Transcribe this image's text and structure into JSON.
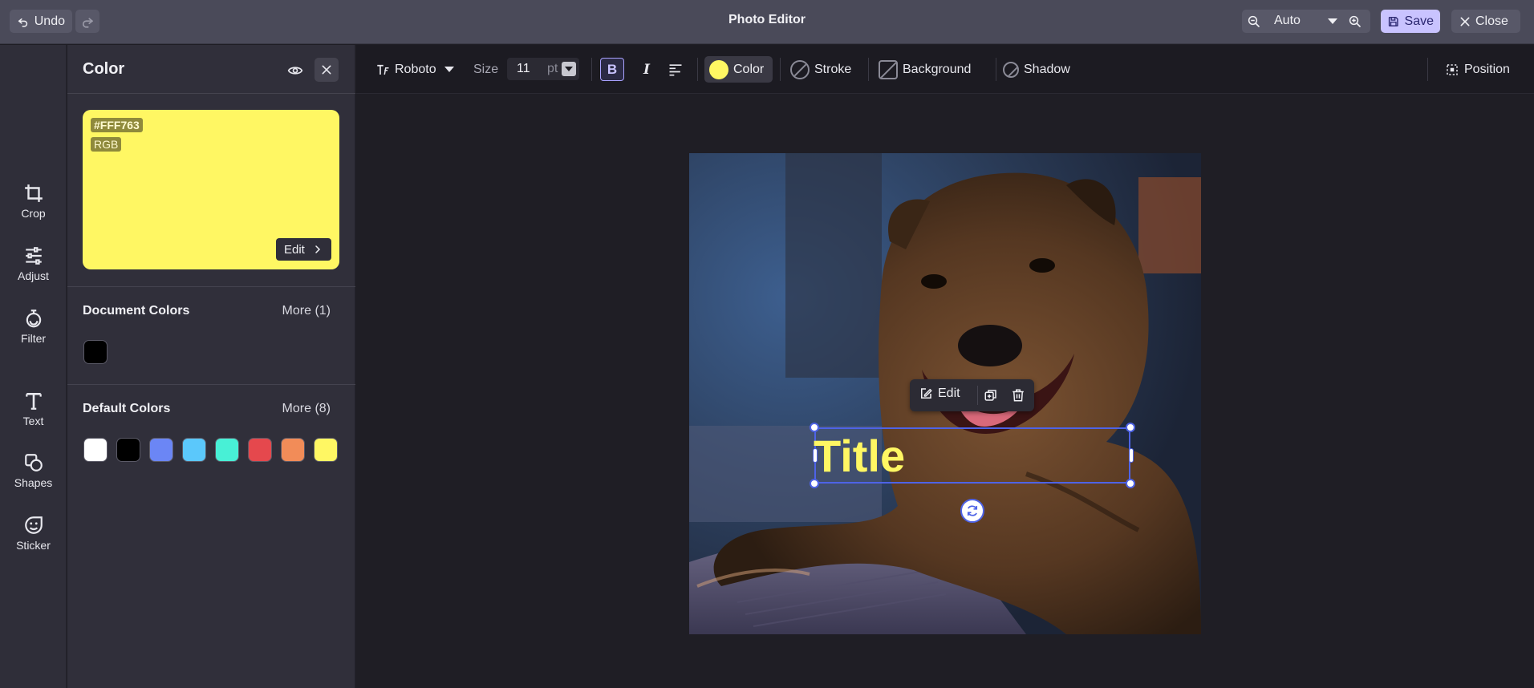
{
  "app": {
    "title": "Photo Editor"
  },
  "topbar": {
    "undo_label": "Undo",
    "zoom_value": "Auto",
    "save_label": "Save",
    "close_label": "Close"
  },
  "rail": {
    "items": [
      {
        "label": "Crop",
        "icon": "crop-icon"
      },
      {
        "label": "Adjust",
        "icon": "sliders-icon"
      },
      {
        "label": "Filter",
        "icon": "filter-icon"
      },
      {
        "label": "Text",
        "icon": "text-icon"
      },
      {
        "label": "Shapes",
        "icon": "shapes-icon"
      },
      {
        "label": "Sticker",
        "icon": "sticker-icon"
      }
    ]
  },
  "panel": {
    "title": "Color",
    "current_color": {
      "hex": "#FFF763",
      "mode": "RGB",
      "edit_label": "Edit"
    },
    "document_colors": {
      "title": "Document Colors",
      "more_label": "More (1)",
      "colors": [
        "#000000"
      ]
    },
    "default_colors": {
      "title": "Default Colors",
      "more_label": "More (8)",
      "colors": [
        "#ffffff",
        "#000000",
        "#6b86f5",
        "#5bc8fb",
        "#48f0d6",
        "#e5484d",
        "#f28c58",
        "#fff763"
      ]
    }
  },
  "toolbar": {
    "font_family": "Roboto",
    "size_label": "Size",
    "size_value": "11",
    "size_unit": "pt",
    "bold_label": "B",
    "italic_label": "I",
    "color_label": "Color",
    "stroke_label": "Stroke",
    "background_label": "Background",
    "shadow_label": "Shadow",
    "position_label": "Position"
  },
  "canvas": {
    "text_element": "Title",
    "float_edit_label": "Edit"
  },
  "colors": {
    "accent": "#4e63e6",
    "save_bg": "#c9c3ff",
    "text_color": "#FFF763"
  }
}
